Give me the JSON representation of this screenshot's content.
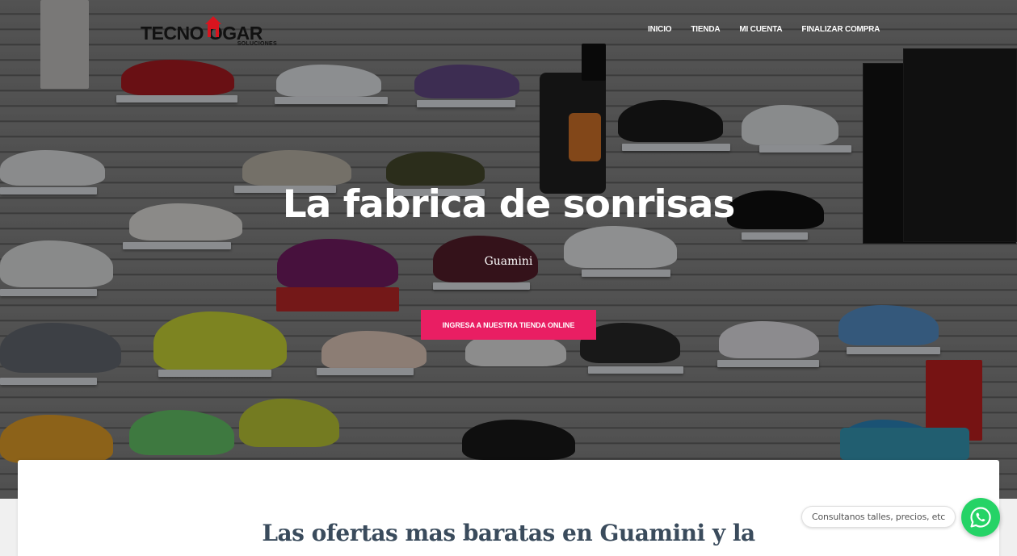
{
  "header": {
    "logo_text": "TECNO   OGAR",
    "logo_sub": "SOLUCIONES",
    "nav": [
      {
        "label": "INICIO"
      },
      {
        "label": "TIENDA"
      },
      {
        "label": "MI CUENTA"
      },
      {
        "label": "FINALIZAR COMPRA"
      }
    ]
  },
  "hero": {
    "title": "La fabrica de sonrisas",
    "subtitle": "Guamini",
    "cta_label": "INGRESA A NUESTRA TIENDA ONLINE"
  },
  "main": {
    "heading": "Las ofertas mas baratas en Guamini y la"
  },
  "whatsapp": {
    "bubble_text": "Consultanos talles, precios, etc",
    "icon": "whatsapp-icon"
  },
  "colors": {
    "accent": "#e91e63",
    "whatsapp": "#25d366",
    "heading": "#3a4b5c"
  }
}
